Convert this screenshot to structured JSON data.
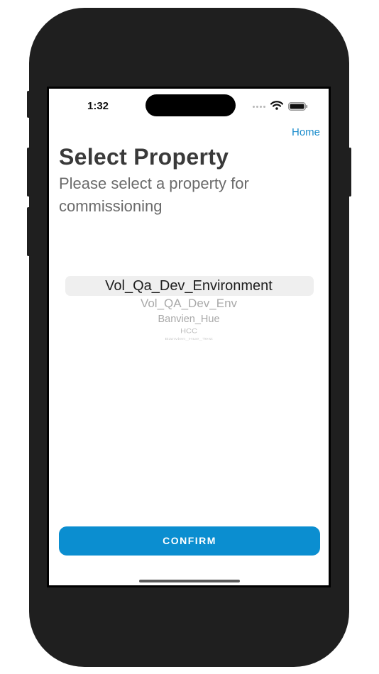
{
  "status_bar": {
    "time": "1:32"
  },
  "nav": {
    "home_label": "Home"
  },
  "header": {
    "title": "Select Property",
    "subtitle": "Please select a property for commissioning"
  },
  "picker": {
    "items": [
      "Vol_Qa_Dev_Environment",
      "Vol_QA_Dev_Env",
      "Banvien_Hue",
      "HCC",
      "Banvien_Hue_Test"
    ],
    "selected_index": 0
  },
  "actions": {
    "confirm_label": "CONFIRM"
  },
  "colors": {
    "accent": "#0b8ed0",
    "link": "#1a8ccc",
    "title": "#3a3a3a",
    "subtitle": "#6a6a6a"
  }
}
